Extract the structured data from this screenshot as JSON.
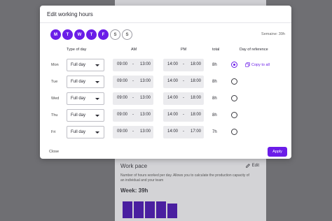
{
  "background": {
    "card_title": "Work pace",
    "edit_label": "Edit",
    "description": "Number of hours worked per day. Allows you to calculate the production capacity of an individual and your team",
    "week_label": "Week: 39h",
    "bar_levels": [
      0.85,
      0.85,
      0.85,
      0.85,
      0.75
    ]
  },
  "modal": {
    "title": "Edit working hours",
    "weekdays": [
      {
        "letter": "M",
        "active": true
      },
      {
        "letter": "T",
        "active": true
      },
      {
        "letter": "W",
        "active": true
      },
      {
        "letter": "T",
        "active": true
      },
      {
        "letter": "F",
        "active": true
      },
      {
        "letter": "S",
        "active": false
      },
      {
        "letter": "S",
        "active": false
      }
    ],
    "semaine": "Semaine: 39h",
    "headers": {
      "type_of_day": "Type of day",
      "am": "AM",
      "pm": "PM",
      "total": "total",
      "day_of_reference": "Day of reference"
    },
    "rows": [
      {
        "day": "Mon",
        "type": "Full day",
        "am_start": "09:00",
        "am_end": "13:00",
        "pm_start": "14:00",
        "pm_end": "18:00",
        "total": "8h",
        "reference": true
      },
      {
        "day": "Tue",
        "type": "Full day",
        "am_start": "09:00",
        "am_end": "13:00",
        "pm_start": "14:00",
        "pm_end": "18:00",
        "total": "8h",
        "reference": false
      },
      {
        "day": "Wed",
        "type": "Full day",
        "am_start": "09:00",
        "am_end": "13:00",
        "pm_start": "14:00",
        "pm_end": "18:00",
        "total": "8h",
        "reference": false
      },
      {
        "day": "Thu",
        "type": "Full day",
        "am_start": "09:00",
        "am_end": "13:00",
        "pm_start": "14:00",
        "pm_end": "18:00",
        "total": "8h",
        "reference": false
      },
      {
        "day": "Fri",
        "type": "Full day",
        "am_start": "09:00",
        "am_end": "13:00",
        "pm_start": "14:00",
        "pm_end": "17:00",
        "total": "7h",
        "reference": false
      }
    ],
    "dash": "-",
    "copy_to_all": "Copy to all",
    "close_label": "Close",
    "apply_label": "Apply"
  },
  "colors": {
    "accent": "#6b1de8",
    "bar": "#4a1fa0"
  }
}
